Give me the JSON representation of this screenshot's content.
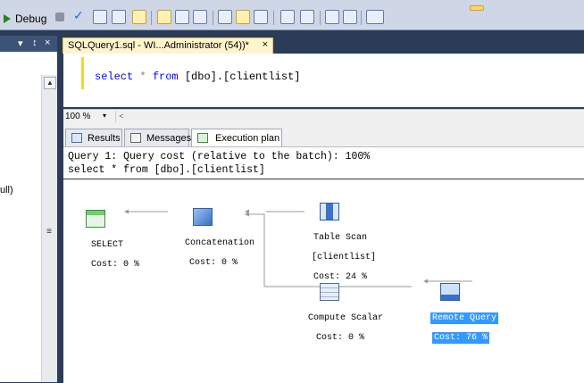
{
  "toolbar": {
    "debug_label": "Debug",
    "icons": [
      "play-icon",
      "stop-icon",
      "parse-check-icon",
      "display-plan-icon",
      "query-designer-icon",
      "results-to-grid-icon",
      "results-to-text-icon",
      "results-to-file-icon",
      "comment-icon",
      "uncomment-icon",
      "decrease-indent-icon",
      "increase-indent-icon",
      "specify-values-icon"
    ]
  },
  "left_panel": {
    "header_glyphs": [
      "▾",
      "↕",
      "×"
    ],
    "visible_text": "ull)"
  },
  "document_tab": {
    "label": "SQLQuery1.sql - WI...Administrator (54))*",
    "close": "×"
  },
  "editor": {
    "kw_select": "select",
    "star": "*",
    "kw_from": "from",
    "table": "[dbo].[clientlist]"
  },
  "zoom": {
    "value": "100 %",
    "arrow": "▾",
    "scroll_left": "<"
  },
  "result_tabs": [
    {
      "label": "Results",
      "active": false
    },
    {
      "label": "Messages",
      "active": false
    },
    {
      "label": "Execution plan",
      "active": true
    }
  ],
  "plan": {
    "query_line": "Query 1: Query cost (relative to the batch): 100%",
    "sql_line": "select * from [dbo].[clientlist]",
    "nodes": [
      {
        "name": "SELECT",
        "cost": "Cost: 0 %"
      },
      {
        "name": "Concatenation",
        "cost": "Cost: 0 %"
      },
      {
        "name": "Table Scan",
        "object": "[clientlist]",
        "cost": "Cost: 24 %"
      },
      {
        "name": "Compute Scalar",
        "cost": "Cost: 0 %"
      },
      {
        "name": "Remote Query",
        "cost": "Cost: 76 %",
        "selected": true
      }
    ]
  },
  "colors": {
    "selection": "#3399ff",
    "keyword": "#0000ff",
    "tab_active_bg": "#fff5cc",
    "frame": "#2b3c59"
  }
}
